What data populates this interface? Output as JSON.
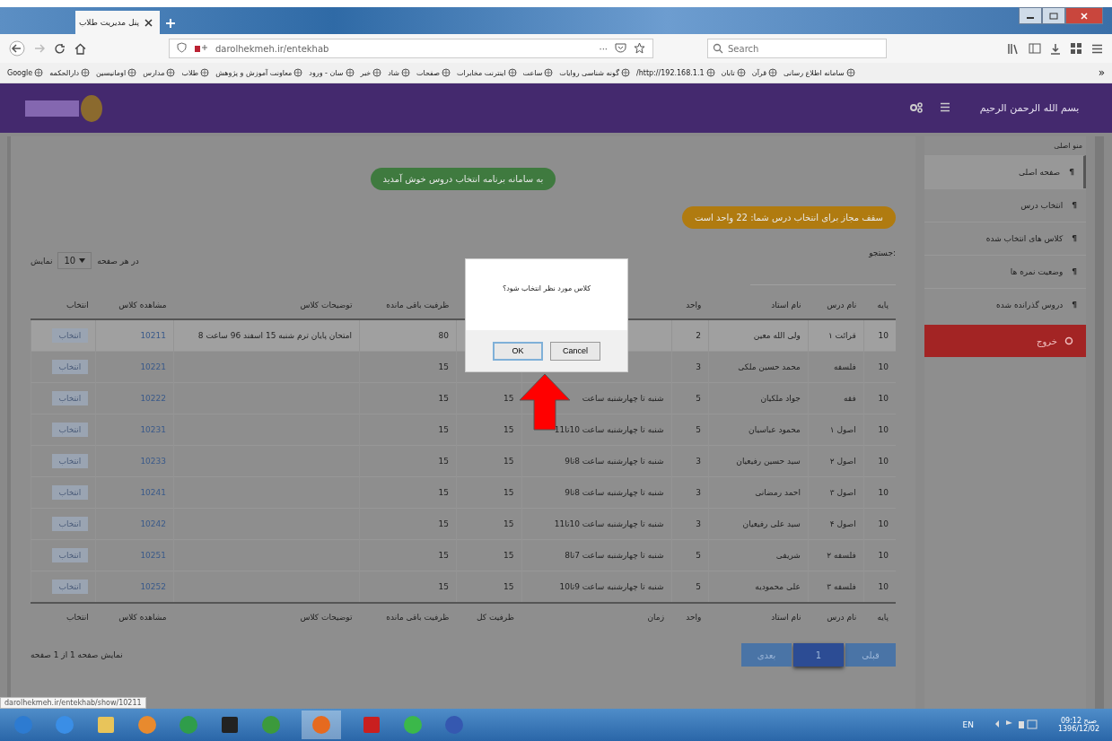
{
  "browser": {
    "tab_title": "پنل مدیریت طلاب",
    "url": "darolhekmeh.ir/entekhab",
    "search_placeholder": "Search",
    "more": "···",
    "bookmarks": [
      "سامانه اطلاع رسانی",
      "قرآن",
      "تابان",
      "http://192.168.1.1/",
      "گونه شناسی روایات",
      "ساعت",
      "اینترنت مخابرات",
      "صفحات",
      "شاد",
      "خبر",
      "سان - ورود",
      "معاونت آموزش و پژوهش",
      "طلاب",
      "مدارس",
      "اومانیسین",
      "دارالحکمه",
      "Google"
    ],
    "overflow": "»"
  },
  "header": {
    "title": "بسم الله الرحمن الرحیم"
  },
  "sidebar": {
    "heading": "منو اصلی",
    "items": [
      {
        "mark": "¶",
        "label": "صفحه اصلی",
        "selected": true
      },
      {
        "mark": "¶",
        "label": "انتخاب درس",
        "selected": false
      },
      {
        "mark": "¶",
        "label": "کلاس های انتخاب شده",
        "selected": false
      },
      {
        "mark": "¶",
        "label": "وضعیت نمره ها",
        "selected": false
      },
      {
        "mark": "¶",
        "label": "دروس گذرانده شده",
        "selected": false
      }
    ],
    "logout": "خروج"
  },
  "alerts": [
    {
      "kind": "success",
      "text": "به سامانه برنامه انتخاب دروس خوش آمدید"
    },
    {
      "kind": "warning",
      "text": "سقف مجاز برای انتخاب درس شما: 22 واحد است"
    }
  ],
  "search_label": "جستجو:",
  "page_length": {
    "prefix": "نمایش",
    "value": "10",
    "suffix": "در هر صفحه"
  },
  "table": {
    "columns": [
      {
        "label": "پایه"
      },
      {
        "label": "نام درس"
      },
      {
        "label": "نام استاد"
      },
      {
        "label": "واحد"
      },
      {},
      {},
      {
        "label": "ظرفیت باقی مانده"
      },
      {
        "label": "توضیحات کلاس"
      },
      {
        "label": "مشاهده کلاس"
      },
      {
        "label": "انتخاب"
      }
    ],
    "rows": [
      {
        "selected": true,
        "grade": "10",
        "course": "قرائت ۱",
        "teacher": "ولی الله معین",
        "units": "2",
        "remaining": "80",
        "notes": "امتحان پایان ترم شنبه 15 اسفند 96 ساعت 8",
        "class_id": "10211",
        "action": "انتخاب"
      },
      {
        "selected": false,
        "grade": "10",
        "course": "فلسفه",
        "teacher": "محمد حسین ملکی",
        "units": "3",
        "remaining": "15",
        "class_id": "10221",
        "action": "انتخاب"
      },
      {
        "selected": false,
        "grade": "10",
        "course": "فقه",
        "teacher": "جواد ملکیان",
        "units": "5",
        "time": "شنبه تا چهارشنبه ساعت",
        "capacity": "15",
        "remaining": "15",
        "class_id": "10222",
        "action": "انتخاب"
      },
      {
        "selected": false,
        "grade": "10",
        "course": "اصول ۱",
        "teacher": "محمود عباسیان",
        "units": "5",
        "time": "شنبه تا چهارشنبه ساعت 10تا11",
        "capacity": "15",
        "remaining": "15",
        "class_id": "10231",
        "action": "انتخاب"
      },
      {
        "selected": false,
        "grade": "10",
        "course": "اصول ۲",
        "teacher": "سید حسین رفیعیان",
        "units": "3",
        "time": "شنبه تا چهارشنبه ساعت 8تا9",
        "capacity": "15",
        "remaining": "15",
        "class_id": "10233",
        "action": "انتخاب"
      },
      {
        "selected": false,
        "grade": "10",
        "course": "اصول ۳",
        "teacher": "احمد رمضانی",
        "units": "3",
        "time": "شنبه تا چهارشنبه ساعت 8تا9",
        "capacity": "15",
        "remaining": "15",
        "class_id": "10241",
        "action": "انتخاب"
      },
      {
        "selected": false,
        "grade": "10",
        "course": "اصول ۴",
        "teacher": "سید علی رفیعیان",
        "units": "3",
        "time": "شنبه تا چهارشنبه ساعت 10تا11",
        "capacity": "15",
        "remaining": "15",
        "class_id": "10242",
        "action": "انتخاب"
      },
      {
        "selected": false,
        "grade": "10",
        "course": "فلسفه ۲",
        "teacher": "شریفی",
        "units": "5",
        "time": "شنبه تا چهارشنبه ساعت 7تا8",
        "capacity": "15",
        "remaining": "15",
        "class_id": "10251",
        "action": "انتخاب"
      },
      {
        "selected": false,
        "grade": "10",
        "course": "فلسفه ۳",
        "teacher": "علی محمودیه",
        "units": "5",
        "time": "شنبه تا چهارشنبه ساعت 9تا10",
        "capacity": "15",
        "remaining": "15",
        "class_id": "10252",
        "action": "انتخاب"
      }
    ],
    "footer_columns": [
      "پایه",
      "نام درس",
      "نام استاد",
      "واحد",
      "زمان",
      "ظرفیت کل",
      "ظرفیت باقی مانده",
      "توضیحات کلاس",
      "مشاهده کلاس",
      "انتخاب"
    ]
  },
  "info": "نمایش صفحه 1 از 1 صفحه",
  "pagination": [
    {
      "label": "قبلی",
      "selected": false
    },
    {
      "label": "1",
      "selected": true
    },
    {
      "label": "بعدی",
      "selected": false
    }
  ],
  "dialog": {
    "message": "کلاس مورد نظر انتخاب شود؟",
    "buttons": [
      {
        "label": "Cancel",
        "focused": false
      },
      {
        "label": "OK",
        "focused": true
      }
    ]
  },
  "status_link": "darolhekmeh.ir/entekhab/show/10211",
  "tray": {
    "language": "EN",
    "time": "09:12 صبح",
    "date": "1396/12/02"
  }
}
